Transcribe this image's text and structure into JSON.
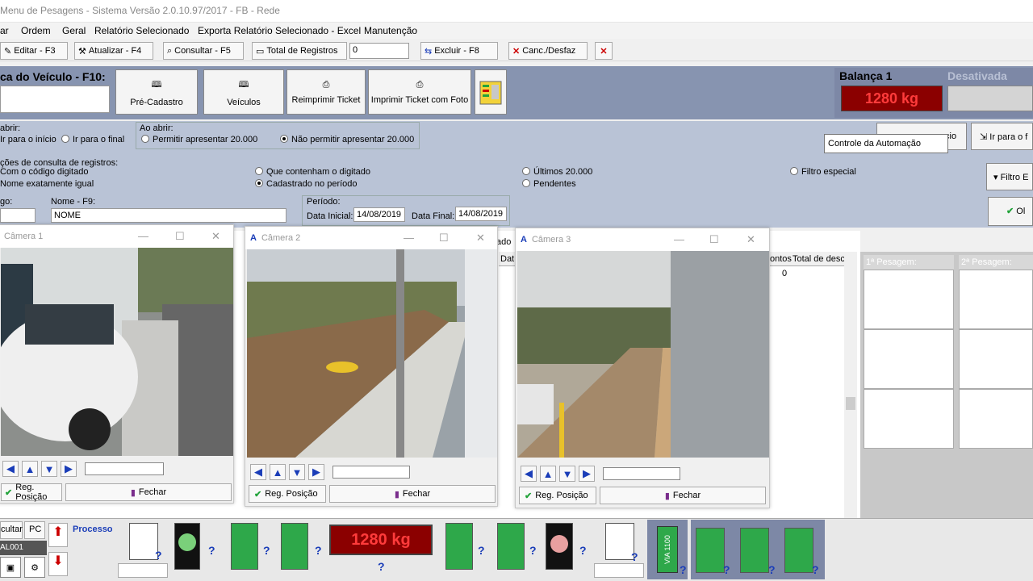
{
  "window": {
    "title": "Menu de Pesagens - Sistema Versão 2.0.10.97/2017 - FB - Rede"
  },
  "menu": [
    "ar",
    "Ordem",
    "Geral",
    "Relatório Selecionado",
    "Exporta Relatório Selecionado - Excel",
    "Manutenção"
  ],
  "toolbar": {
    "edit": "Editar - F3",
    "update": "Atualizar - F4",
    "consult": "Consultar - F5",
    "total_records": "Total de Registros",
    "total_value": "0",
    "delete": "Excluir - F8",
    "cancel": "Canc./Desfaz"
  },
  "vehicle": {
    "plate_label": "ca do Veículo - F10:"
  },
  "actions": {
    "pre_cadastro": "Pré-Cadastro",
    "veiculos": "Veículos",
    "reimprimir": "Reimprimir Ticket",
    "imprimir_foto": "Imprimir Ticket com Foto"
  },
  "balanca": {
    "title": "Balança 1",
    "status": "Desativada",
    "weight": "1280 kg"
  },
  "open_opts": {
    "label_a": "abrir:",
    "go_start": "Ir para o início",
    "go_end": "Ir para o final",
    "label_b": "Ao abrir:",
    "allow": "Permitir apresentar 20.000",
    "deny": "Não permitir apresentar 20.000"
  },
  "tooltip": "Controle da Automação",
  "side_buttons": {
    "right1": "cio",
    "right2": "Ir para o f",
    "filter": "Filtro E",
    "ok": "Ol"
  },
  "consult_opts": {
    "label": "ções de consulta de registros:",
    "code": "Com o código digitado",
    "exact": "Nome exatamente igual",
    "contains": "Que contenham o digitado",
    "period": "Cadastrado no período",
    "last": "Últimos 20.000",
    "pending": "Pendentes",
    "special": "Filtro especial"
  },
  "search": {
    "code_label": "go:",
    "name_label": "Nome - F9:",
    "name_value": "NOME",
    "period_label": "Período:",
    "start_label": "Data Inicial:",
    "start_value": "14/08/2019",
    "end_label": "Data Final:",
    "end_value": "14/08/2019"
  },
  "table": {
    "col_ado": "ado",
    "col_dat": "Dat",
    "col_pontos": "ontos",
    "col_total": "Total de desc",
    "total_value": "0",
    "first_weigh": "1ª Pesagem:",
    "second_weigh": "2ª Pesagem:"
  },
  "cameras": [
    {
      "title": "Câmera 1",
      "reg": "Reg. Posição",
      "close": "Fechar"
    },
    {
      "title": "Câmera 2",
      "reg": "Reg. Posição",
      "close": "Fechar"
    },
    {
      "title": "Câmera 3",
      "reg": "Reg. Posição",
      "close": "Fechar"
    }
  ],
  "bottom": {
    "cultar": "cultar",
    "pc": "PC",
    "processo": "Processo",
    "code": "AL001",
    "weight": "1280 kg",
    "device": "VIA 1100"
  },
  "colors": {
    "band_dark": "#8794b0",
    "band_light": "#b9c3d6",
    "weight_bg": "#8b0000",
    "weight_fg": "#ff3b3b",
    "accent": "#1a3db8",
    "green": "#22a33a"
  }
}
